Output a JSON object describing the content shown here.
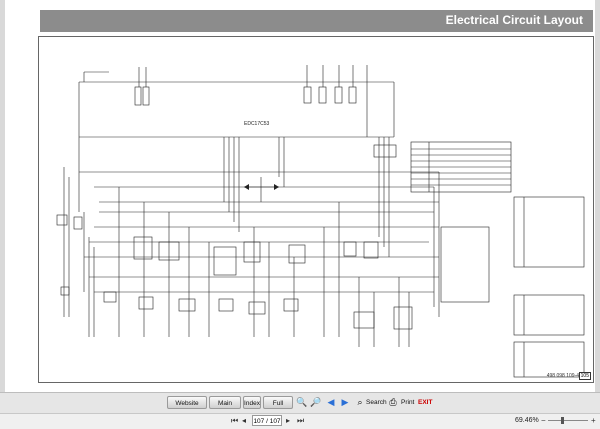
{
  "header": {
    "title": "Electrical Circuit Layout"
  },
  "diagram": {
    "ecu_label": "EDC17C53",
    "part_number": "498 098 109-4",
    "page_badge": "105"
  },
  "toolbar": {
    "website_label": "Website",
    "main_menu_label": "Main Menu",
    "index_label": "Index",
    "full_screen_label": "Full Screen",
    "search_label": "Search",
    "print_label": "Print",
    "exit_label": "EXIT"
  },
  "status": {
    "page_value": "107 / 107",
    "zoom": "69.46%",
    "zoom_level": 0.35
  },
  "colors": {
    "exit": "#cc0000",
    "header_bar": "#8c8c8c"
  }
}
